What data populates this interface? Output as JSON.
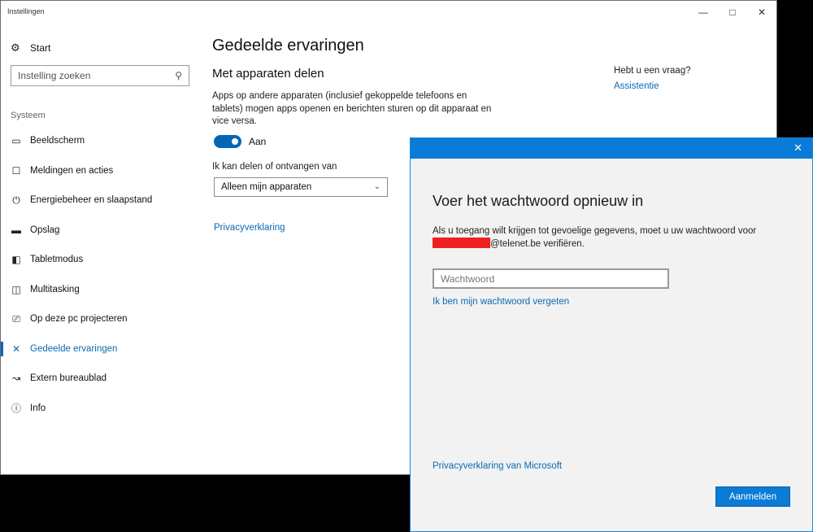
{
  "window": {
    "title": "Instellingen",
    "minimize_icon": "minimize-icon",
    "maximize_icon": "maximize-icon",
    "close_icon": "close-icon"
  },
  "sidebar": {
    "start_label": "Start",
    "search_placeholder": "Instelling zoeken",
    "section_header": "Systeem",
    "items": [
      {
        "label": "Beeldscherm",
        "icon": "monitor-icon"
      },
      {
        "label": "Meldingen en acties",
        "icon": "notification-icon"
      },
      {
        "label": "Energiebeheer en slaapstand",
        "icon": "power-icon"
      },
      {
        "label": "Opslag",
        "icon": "storage-icon"
      },
      {
        "label": "Tabletmodus",
        "icon": "tablet-icon"
      },
      {
        "label": "Multitasking",
        "icon": "multitasking-icon"
      },
      {
        "label": "Op deze pc projecteren",
        "icon": "project-icon"
      },
      {
        "label": "Gedeelde ervaringen",
        "icon": "shared-experiences-icon",
        "active": true
      },
      {
        "label": "Extern bureaublad",
        "icon": "remote-desktop-icon"
      },
      {
        "label": "Info",
        "icon": "info-icon"
      }
    ]
  },
  "main": {
    "page_title": "Gedeelde ervaringen",
    "section_title": "Met apparaten delen",
    "description": "Apps op andere apparaten (inclusief gekoppelde telefoons en tablets) mogen apps openen en berichten sturen op dit apparaat en vice versa.",
    "toggle_label": "Aan",
    "toggle_on": true,
    "share_label": "Ik kan delen of ontvangen van",
    "select_value": "Alleen mijn apparaten",
    "privacy_link": "Privacyverklaring"
  },
  "help": {
    "question": "Hebt u een vraag?",
    "link": "Assistentie"
  },
  "dialog": {
    "title": "Voer het wachtwoord opnieuw in",
    "desc_line1": "Als u toegang wilt krijgen tot gevoelige gegevens, moet u uw wachtwoord voor",
    "email_suffix": "@telenet.be verifiëren.",
    "password_placeholder": "Wachtwoord",
    "forgot_link": "Ik ben mijn wachtwoord vergeten",
    "privacy_link": "Privacyverklaring van Microsoft",
    "signin_button": "Aanmelden",
    "accent_color": "#0a7bd6"
  }
}
